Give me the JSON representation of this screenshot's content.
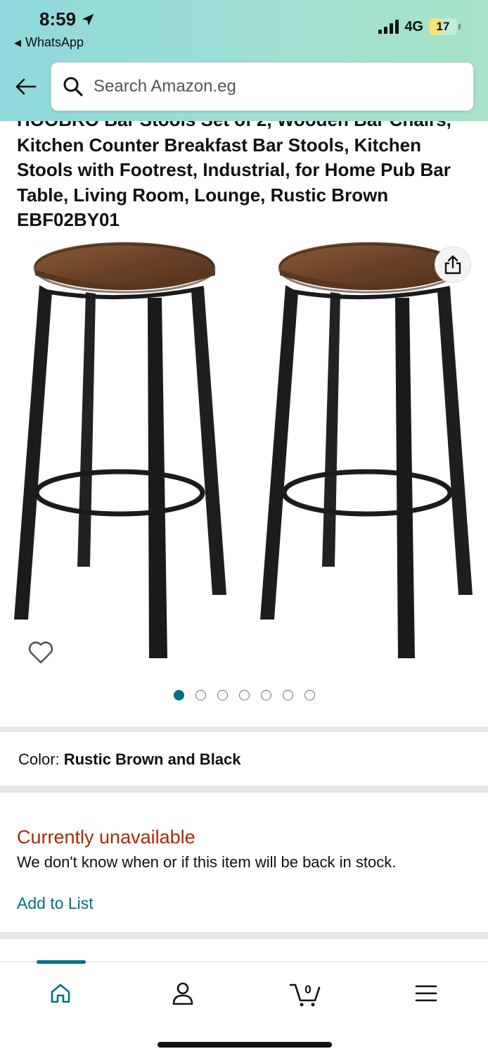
{
  "status_bar": {
    "time": "8:59",
    "back_app": "WhatsApp",
    "network": "4G",
    "battery": "17"
  },
  "search": {
    "placeholder": "Search Amazon.eg"
  },
  "product": {
    "title": "HOOBRO Bar Stools Set of 2, Wooden Bar Chairs, Kitchen Counter Breakfast Bar Stools, Kitchen Stools with Footrest, Industrial, for Home Pub Bar Table, Living Room, Lounge, Rustic Brown EBF02BY01",
    "image_count": 7,
    "active_image": 1,
    "color_label": "Color:",
    "color_value": "Rustic Brown and Black",
    "availability": "Currently unavailable",
    "availability_note": "We don't know when or if this item will be back in stock.",
    "add_to_list": "Add to List"
  },
  "colors": {
    "accent": "#007185",
    "unavailable": "#b12704",
    "header_start": "#8fd9dc",
    "header_end": "#a6e3c8"
  },
  "bottom_nav": {
    "items": [
      {
        "name": "home",
        "icon": "home-icon",
        "active": true
      },
      {
        "name": "account",
        "icon": "user-icon",
        "active": false
      },
      {
        "name": "cart",
        "icon": "cart-icon",
        "badge": "0",
        "active": false
      },
      {
        "name": "menu",
        "icon": "menu-icon",
        "active": false
      }
    ]
  }
}
